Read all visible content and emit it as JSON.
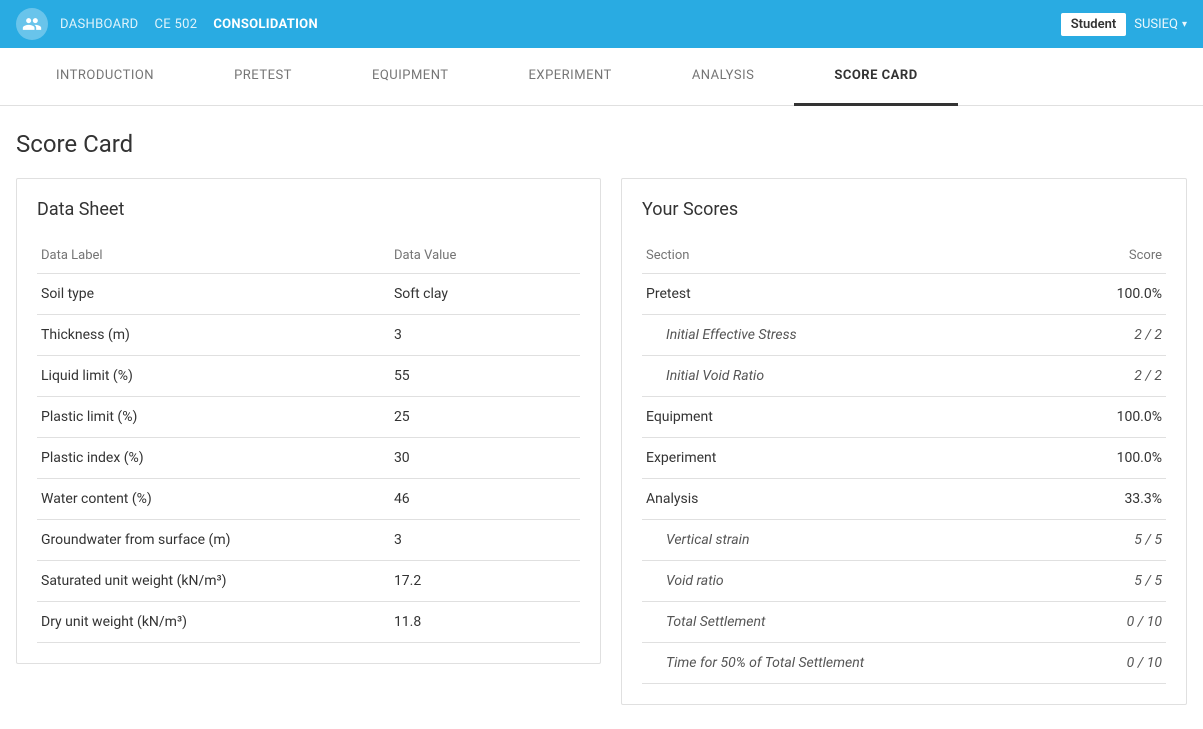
{
  "topnav": {
    "dashboard_label": "DASHBOARD",
    "ce502_label": "CE 502",
    "consolidation_label": "CONSOLIDATION",
    "student_badge": "Student",
    "user_name": "SUSIEQ",
    "user_icon": "👤"
  },
  "tabs": [
    {
      "id": "introduction",
      "label": "INTRODUCTION",
      "active": false
    },
    {
      "id": "pretest",
      "label": "PRETEST",
      "active": false
    },
    {
      "id": "equipment",
      "label": "EQUIPMENT",
      "active": false
    },
    {
      "id": "experiment",
      "label": "EXPERIMENT",
      "active": false
    },
    {
      "id": "analysis",
      "label": "ANALYSIS",
      "active": false
    },
    {
      "id": "score-card",
      "label": "SCORE CARD",
      "active": true
    }
  ],
  "page_title": "Score Card",
  "data_sheet": {
    "title": "Data Sheet",
    "col_label": "Data Label",
    "col_value": "Data Value",
    "rows": [
      {
        "label": "Soil type",
        "value": "Soft clay"
      },
      {
        "label": "Thickness (m)",
        "value": "3"
      },
      {
        "label": "Liquid limit (%)",
        "value": "55"
      },
      {
        "label": "Plastic limit (%)",
        "value": "25"
      },
      {
        "label": "Plastic index (%)",
        "value": "30"
      },
      {
        "label": "Water content (%)",
        "value": "46"
      },
      {
        "label": "Groundwater from surface (m)",
        "value": "3"
      },
      {
        "label": "Saturated unit weight (kN/m³)",
        "value": "17.2"
      },
      {
        "label": "Dry unit weight (kN/m³)",
        "value": "11.8"
      }
    ]
  },
  "scores": {
    "title": "Your Scores",
    "col_section": "Section",
    "col_score": "Score",
    "rows": [
      {
        "section": "Pretest",
        "score": "100.0%",
        "sub": false
      },
      {
        "section": "Initial Effective Stress",
        "score": "2 / 2",
        "sub": true
      },
      {
        "section": "Initial Void Ratio",
        "score": "2 / 2",
        "sub": true
      },
      {
        "section": "Equipment",
        "score": "100.0%",
        "sub": false
      },
      {
        "section": "Experiment",
        "score": "100.0%",
        "sub": false
      },
      {
        "section": "Analysis",
        "score": "33.3%",
        "sub": false
      },
      {
        "section": "Vertical strain",
        "score": "5 / 5",
        "sub": true
      },
      {
        "section": "Void ratio",
        "score": "5 / 5",
        "sub": true
      },
      {
        "section": "Total Settlement",
        "score": "0 / 10",
        "sub": true
      },
      {
        "section": "Time for 50% of Total Settlement",
        "score": "0 / 10",
        "sub": true
      }
    ]
  }
}
